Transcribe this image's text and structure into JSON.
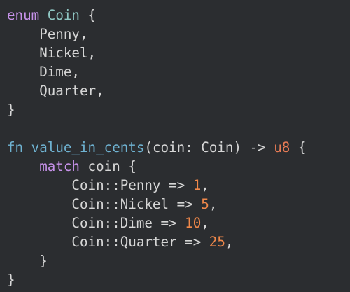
{
  "editor": {
    "background": "#2b2d30",
    "lines": [
      [
        {
          "t": "kw",
          "v": "enum"
        },
        {
          "t": "plain",
          "v": " "
        },
        {
          "t": "ty",
          "v": "Coin"
        },
        {
          "t": "plain",
          "v": " {"
        }
      ],
      [
        {
          "t": "plain",
          "v": "    Penny,"
        }
      ],
      [
        {
          "t": "plain",
          "v": "    Nickel,"
        }
      ],
      [
        {
          "t": "plain",
          "v": "    Dime,"
        }
      ],
      [
        {
          "t": "plain",
          "v": "    Quarter,"
        }
      ],
      [
        {
          "t": "plain",
          "v": "}"
        }
      ],
      [
        {
          "t": "plain",
          "v": ""
        }
      ],
      [
        {
          "t": "kw-fn",
          "v": "fn"
        },
        {
          "t": "plain",
          "v": " "
        },
        {
          "t": "kw-fn",
          "v": "value_in_cents"
        },
        {
          "t": "plain",
          "v": "(coin: Coin) -> "
        },
        {
          "t": "ty2",
          "v": "u8"
        },
        {
          "t": "plain",
          "v": " {"
        }
      ],
      [
        {
          "t": "plain",
          "v": "    "
        },
        {
          "t": "kw",
          "v": "match"
        },
        {
          "t": "plain",
          "v": " coin {"
        }
      ],
      [
        {
          "t": "plain",
          "v": "        Coin::Penny => "
        },
        {
          "t": "num",
          "v": "1"
        },
        {
          "t": "plain",
          "v": ","
        }
      ],
      [
        {
          "t": "plain",
          "v": "        Coin::Nickel => "
        },
        {
          "t": "num",
          "v": "5"
        },
        {
          "t": "plain",
          "v": ","
        }
      ],
      [
        {
          "t": "plain",
          "v": "        Coin::Dime => "
        },
        {
          "t": "num",
          "v": "10"
        },
        {
          "t": "plain",
          "v": ","
        }
      ],
      [
        {
          "t": "plain",
          "v": "        Coin::Quarter => "
        },
        {
          "t": "num",
          "v": "25"
        },
        {
          "t": "plain",
          "v": ","
        }
      ],
      [
        {
          "t": "plain",
          "v": "    }"
        }
      ],
      [
        {
          "t": "plain",
          "v": "}"
        }
      ]
    ]
  }
}
